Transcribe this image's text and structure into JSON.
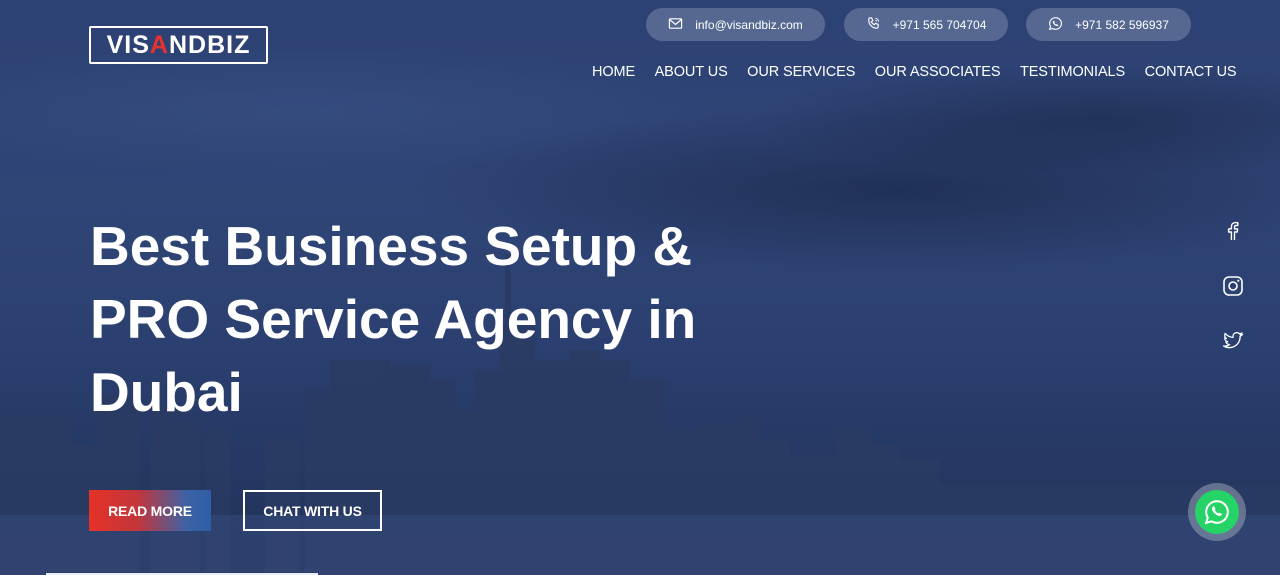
{
  "brand": {
    "logo_pre": "VIS",
    "logo_accent": "A",
    "logo_post": "NDBIZ"
  },
  "contact": {
    "email": "info@visandbiz.com",
    "phone1": "+971 565 704704",
    "phone2": "+971 582 596937"
  },
  "nav": {
    "items": [
      "HOME",
      "ABOUT US",
      "OUR SERVICES",
      "OUR ASSOCIATES",
      "TESTIMONIALS",
      "CONTACT US"
    ]
  },
  "hero": {
    "line1": "Best Business Setup &",
    "line2": "PRO Service Agency in",
    "line3": "Dubai",
    "read_more": "READ MORE",
    "chat": "CHAT WITH US"
  },
  "social": {
    "icons": [
      "facebook-icon",
      "instagram-icon",
      "twitter-icon"
    ]
  },
  "colors": {
    "accent_red": "#e53227",
    "accent_blue": "#2f5ea6",
    "whatsapp": "#25d366",
    "overlay": "#2d4274"
  }
}
